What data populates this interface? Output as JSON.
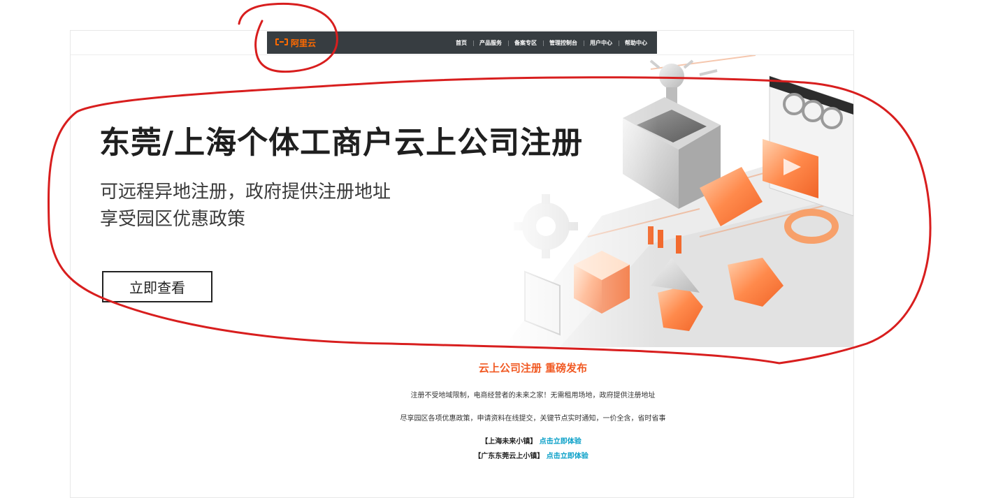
{
  "header": {
    "logo_text": "阿里云",
    "nav": [
      "首页",
      "产品服务",
      "备案专区",
      "管理控制台",
      "用户中心",
      "帮助中心"
    ]
  },
  "hero": {
    "title": "东莞/上海个体工商户云上公司注册",
    "subtitle_line1": "可远程异地注册，政府提供注册地址",
    "subtitle_line2": "享受园区优惠政策",
    "cta_label": "立即查看"
  },
  "content": {
    "title": "云上公司注册 重磅发布",
    "para1": "注册不受地域限制，电商经营者的未来之家！无需租用场地，政府提供注册地址",
    "para2": "尽享园区各项优惠政策，申请资料在线提交，关键节点实时通知，一价全含，省时省事",
    "links": [
      {
        "prefix": "【上海未来小镇】",
        "link": "点击立即体验"
      },
      {
        "prefix": "【广东东莞云上小镇】",
        "link": "点击立即体验"
      }
    ]
  },
  "colors": {
    "accent": "#ff6a00",
    "title_orange": "#f15a24",
    "link_cyan": "#0aa0c8",
    "nav_bg": "#373d41",
    "annotation_red": "#d81e1e"
  }
}
